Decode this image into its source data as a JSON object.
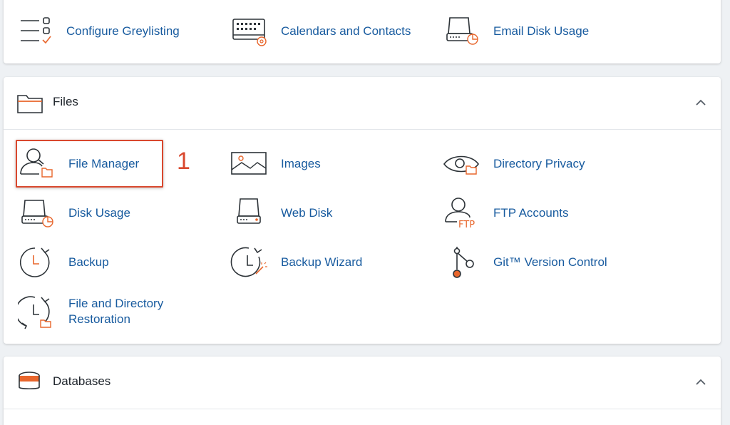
{
  "top_items": [
    {
      "label": "Configure Greylisting",
      "icon": "greylisting-list-icon"
    },
    {
      "label": "Calendars and Contacts",
      "icon": "calendar-at-icon"
    },
    {
      "label": "Email Disk Usage",
      "icon": "disk-usage-icon"
    }
  ],
  "files": {
    "title": "Files",
    "items": [
      {
        "label": "File Manager",
        "icon": "file-manager-icon"
      },
      {
        "label": "Images",
        "icon": "image-icon"
      },
      {
        "label": "Directory Privacy",
        "icon": "eye-folder-icon"
      },
      {
        "label": "Disk Usage",
        "icon": "disk-usage-icon"
      },
      {
        "label": "Web Disk",
        "icon": "drive-icon"
      },
      {
        "label": "FTP Accounts",
        "icon": "ftp-user-icon"
      },
      {
        "label": "Backup",
        "icon": "clock-arrow-icon"
      },
      {
        "label": "Backup Wizard",
        "icon": "clock-wand-icon"
      },
      {
        "label": "Git™ Version Control",
        "icon": "git-branch-icon"
      },
      {
        "label": "File and Directory Restoration",
        "label_line1": "File and Directory",
        "label_line2": "Restoration",
        "icon": "restore-clock-icon"
      }
    ]
  },
  "databases": {
    "title": "Databases"
  },
  "annotation": {
    "text": "1"
  },
  "colors": {
    "link": "#185b9f",
    "accent": "#e8662c",
    "highlight": "#d9482e",
    "icon_stroke": "#2d3338"
  }
}
